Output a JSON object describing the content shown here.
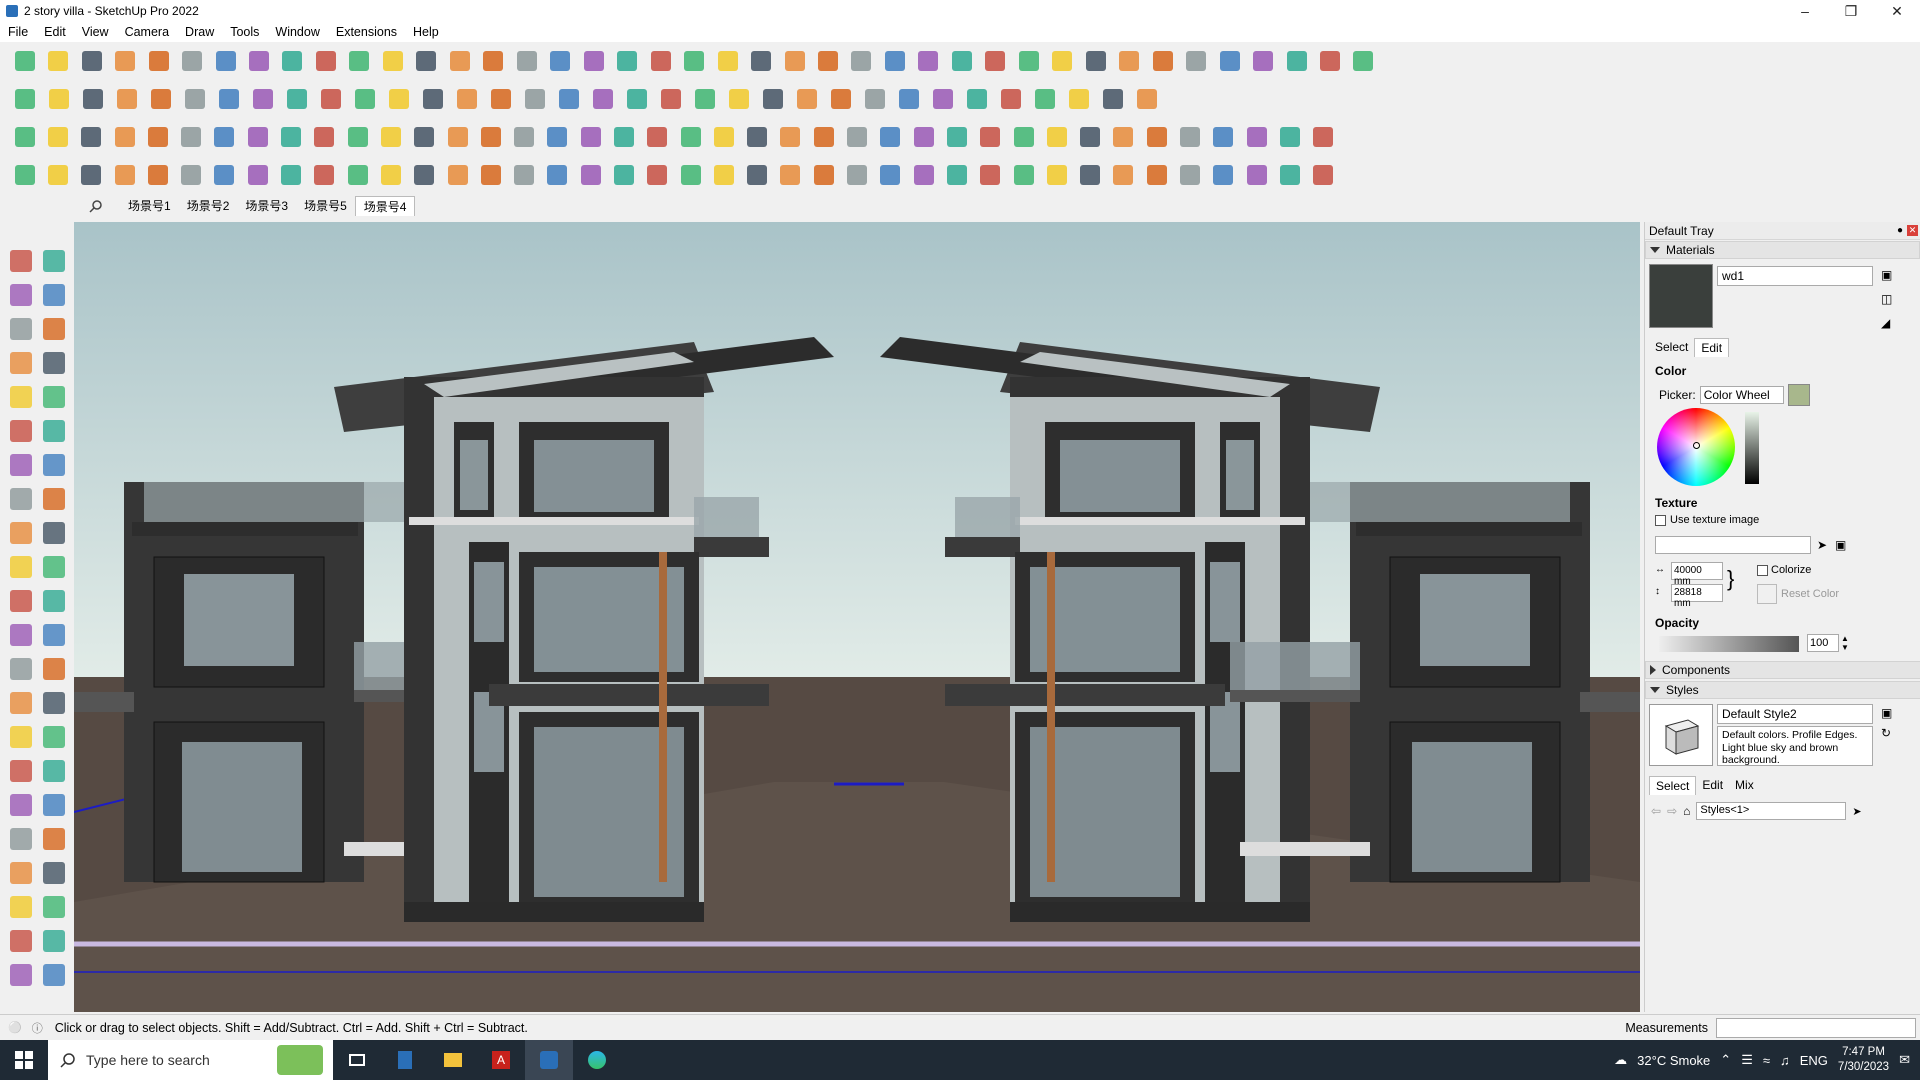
{
  "window": {
    "title": "2 story villa - SketchUp Pro 2022",
    "controls": [
      "minimize-icon",
      "restore-icon",
      "close-icon"
    ]
  },
  "menu": [
    "File",
    "Edit",
    "View",
    "Camera",
    "Draw",
    "Tools",
    "Window",
    "Extensions",
    "Help"
  ],
  "scenes": {
    "tabs": [
      "场景号1",
      "场景号2",
      "场景号3",
      "场景号5",
      "场景号4"
    ],
    "active_index": 4
  },
  "tray": {
    "title": "Default Tray",
    "materials": {
      "header": "Materials",
      "material_name": "wd1",
      "swatch_color": "#3a3f3c",
      "tabs": [
        "Select",
        "Edit"
      ],
      "active_tab": "Edit",
      "color_label": "Color",
      "picker_label": "Picker:",
      "picker_value": "Color Wheel",
      "texture_label": "Texture",
      "use_texture_label": "Use texture image",
      "width_value": "40000 mm",
      "height_value": "28818 mm",
      "colorize_label": "Colorize",
      "reset_color_label": "Reset Color",
      "opacity_label": "Opacity",
      "opacity_value": "100"
    },
    "components": {
      "header": "Components"
    },
    "styles": {
      "header": "Styles",
      "style_name": "Default Style2",
      "description": "Default colors. Profile Edges. Light blue sky and brown background.",
      "tabs": [
        "Select",
        "Edit",
        "Mix"
      ],
      "active_tab": "Select",
      "collection_value": "Styles<1>"
    }
  },
  "status": {
    "hint": "Click or drag to select objects. Shift = Add/Subtract. Ctrl = Add. Shift + Ctrl = Subtract.",
    "measurements_label": "Measurements"
  },
  "taskbar": {
    "search_placeholder": "Type here to search",
    "weather": "32°C  Smoke",
    "language": "ENG",
    "time": "7:47 PM",
    "date": "7/30/2023"
  },
  "colors": {
    "sky": "#bfd3d6",
    "ground": "#5a4d46",
    "wall_dark": "#3a3a3a",
    "wall_light": "#bcc3c3",
    "accent": "#2a6fb8"
  }
}
